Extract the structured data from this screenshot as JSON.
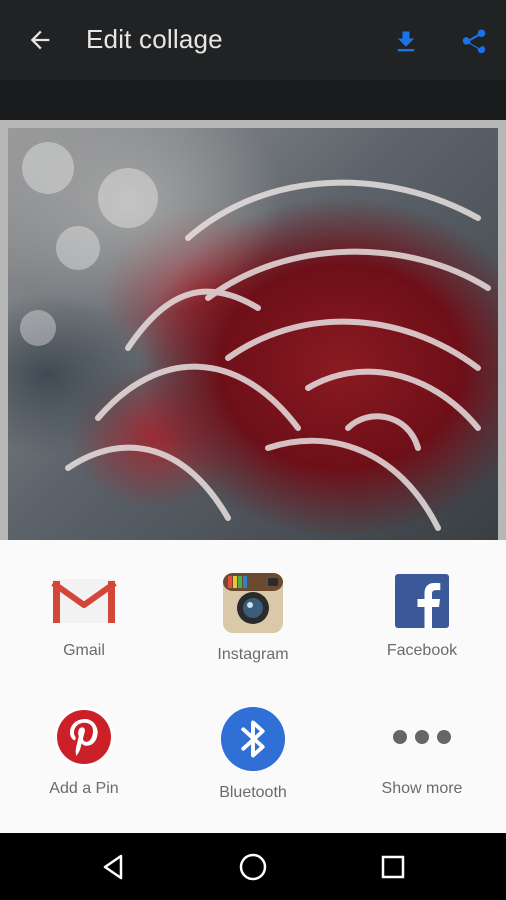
{
  "toolbar": {
    "title": "Edit collage",
    "back_icon": "arrow-back-icon",
    "download_icon": "download-icon",
    "share_icon": "share-icon",
    "accent_color": "#1a73e8"
  },
  "share_sheet": {
    "items": [
      {
        "label": "Gmail",
        "icon": "gmail-icon"
      },
      {
        "label": "Instagram",
        "icon": "instagram-icon"
      },
      {
        "label": "Facebook",
        "icon": "facebook-icon"
      },
      {
        "label": "Add a Pin",
        "icon": "pinterest-icon"
      },
      {
        "label": "Bluetooth",
        "icon": "bluetooth-icon"
      },
      {
        "label": "Show more",
        "icon": "more-horizontal-icon"
      }
    ]
  },
  "navbar": {
    "back": "nav-back-icon",
    "home": "nav-home-icon",
    "recents": "nav-recents-icon"
  }
}
